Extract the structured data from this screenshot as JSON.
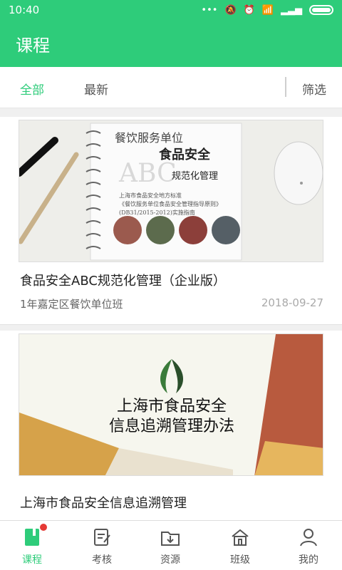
{
  "status": {
    "time": "10:40"
  },
  "appbar": {
    "title": "课程"
  },
  "filters": {
    "all": "全部",
    "latest": "最新",
    "filter": "筛选"
  },
  "courses": [
    {
      "title": "食品安全ABC规范化管理（企业版）",
      "subtitle": "1年嘉定区餐饮单位班",
      "date": "2018-09-27",
      "image_text": {
        "line1": "餐饮服务单位",
        "line2": "食品安全",
        "abc": "ABC",
        "line3": "规范化管理",
        "line4": "上海市食品安全地方标准",
        "line5": "《餐饮服务单位食品安全管理指导原则》",
        "line6": "(DB31/2015-2012)实施指南"
      }
    },
    {
      "title": "上海市食品安全信息追溯管理",
      "subtitle": "",
      "date": "",
      "image_text": {
        "line1": "上海市食品安全",
        "line2": "信息追溯管理办法"
      }
    }
  ],
  "bottom_nav": [
    {
      "label": "课程",
      "icon": "book-icon"
    },
    {
      "label": "考核",
      "icon": "exam-icon"
    },
    {
      "label": "资源",
      "icon": "download-folder-icon"
    },
    {
      "label": "班级",
      "icon": "home-icon"
    },
    {
      "label": "我的",
      "icon": "user-icon"
    }
  ],
  "colors": {
    "accent": "#2ecc7a",
    "badge": "#e53935"
  }
}
